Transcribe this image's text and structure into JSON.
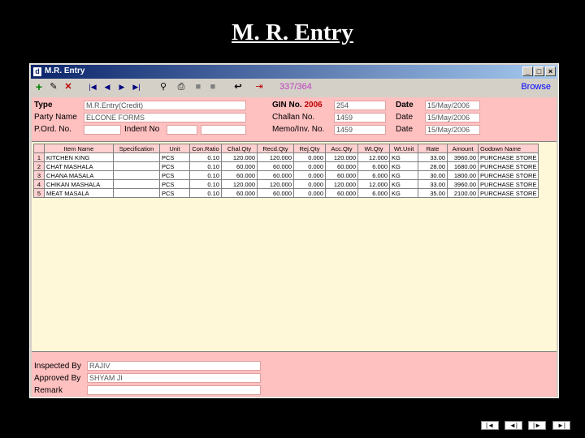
{
  "slide": {
    "title": "M. R. Entry"
  },
  "window": {
    "title": "M.R. Entry",
    "app_icon_letter": "d",
    "min_label": "_",
    "max_label": "□",
    "close_label": "×"
  },
  "toolbar": {
    "record_counter": "337/364",
    "browse_label": "Browse"
  },
  "header": {
    "type_label": "Type",
    "type_value": "M.R.Entry(Credit)",
    "party_label": "Party Name",
    "party_value": "ELCONE  FORMS",
    "pord_label": "P.Ord. No.",
    "pord_value": "",
    "indent_label": "Indent No",
    "indent_value": "",
    "gin_label": "GIN No.",
    "gin_year": "2006",
    "gin_value": "254",
    "challan_label": "Challan No.",
    "challan_value": "1459",
    "memo_label": "Memo/Inv. No.",
    "memo_value": "1459",
    "date_label": "Date",
    "date_value": "15/May/2006",
    "date2_label": "Date",
    "date2_value": "15/May/2006",
    "date3_label": "Date",
    "date3_value": "15/May/2006"
  },
  "grid": {
    "columns": [
      "Item Name",
      "Specification",
      "Unit",
      "Con.Ratio",
      "Chal.Qty",
      "Recd.Qty",
      "Rej.Qty",
      "Acc.Qty",
      "Wt.Qty",
      "Wt.Unit",
      "Rate",
      "Amount",
      "Godown Name"
    ],
    "rows": [
      {
        "no": "1",
        "item": "KITCHEN KING",
        "spec": "",
        "unit": "PCS",
        "ratio": "0.10",
        "chal": "120.000",
        "recd": "120.000",
        "rej": "0.000",
        "acc": "120.000",
        "wt": "12.000",
        "wtunit": "KG",
        "rate": "33.00",
        "amount": "3960.00",
        "godown": "PURCHASE STORE"
      },
      {
        "no": "2",
        "item": "CHAT MASHALA",
        "spec": "",
        "unit": "PCS",
        "ratio": "0.10",
        "chal": "60.000",
        "recd": "60.000",
        "rej": "0.000",
        "acc": "60.000",
        "wt": "6.000",
        "wtunit": "KG",
        "rate": "28.00",
        "amount": "1680.00",
        "godown": "PURCHASE STORE"
      },
      {
        "no": "3",
        "item": "CHANA  MASALA",
        "spec": "",
        "unit": "PCS",
        "ratio": "0.10",
        "chal": "60.000",
        "recd": "60.000",
        "rej": "0.000",
        "acc": "60.000",
        "wt": "6.000",
        "wtunit": "KG",
        "rate": "30.00",
        "amount": "1800.00",
        "godown": "PURCHASE STORE"
      },
      {
        "no": "4",
        "item": "CHIKAN MASHALA",
        "spec": "",
        "unit": "PCS",
        "ratio": "0.10",
        "chal": "120.000",
        "recd": "120.000",
        "rej": "0.000",
        "acc": "120.000",
        "wt": "12.000",
        "wtunit": "KG",
        "rate": "33.00",
        "amount": "3960.00",
        "godown": "PURCHASE STORE"
      },
      {
        "no": "5",
        "item": "MEAT  MASALA",
        "spec": "",
        "unit": "PCS",
        "ratio": "0.10",
        "chal": "60.000",
        "recd": "60.000",
        "rej": "0.000",
        "acc": "60.000",
        "wt": "6.000",
        "wtunit": "KG",
        "rate": "35.00",
        "amount": "2100.00",
        "godown": "PURCHASE STORE"
      }
    ]
  },
  "footer": {
    "inspected_label": "Inspected By",
    "inspected_value": "RAJIV",
    "approved_label": "Approved By",
    "approved_value": "SHYAM JI",
    "remark_label": "Remark",
    "remark_value": ""
  },
  "slide_nav": {
    "first": "|◄",
    "prev": "◄|",
    "next": "|►",
    "last": "►|"
  }
}
